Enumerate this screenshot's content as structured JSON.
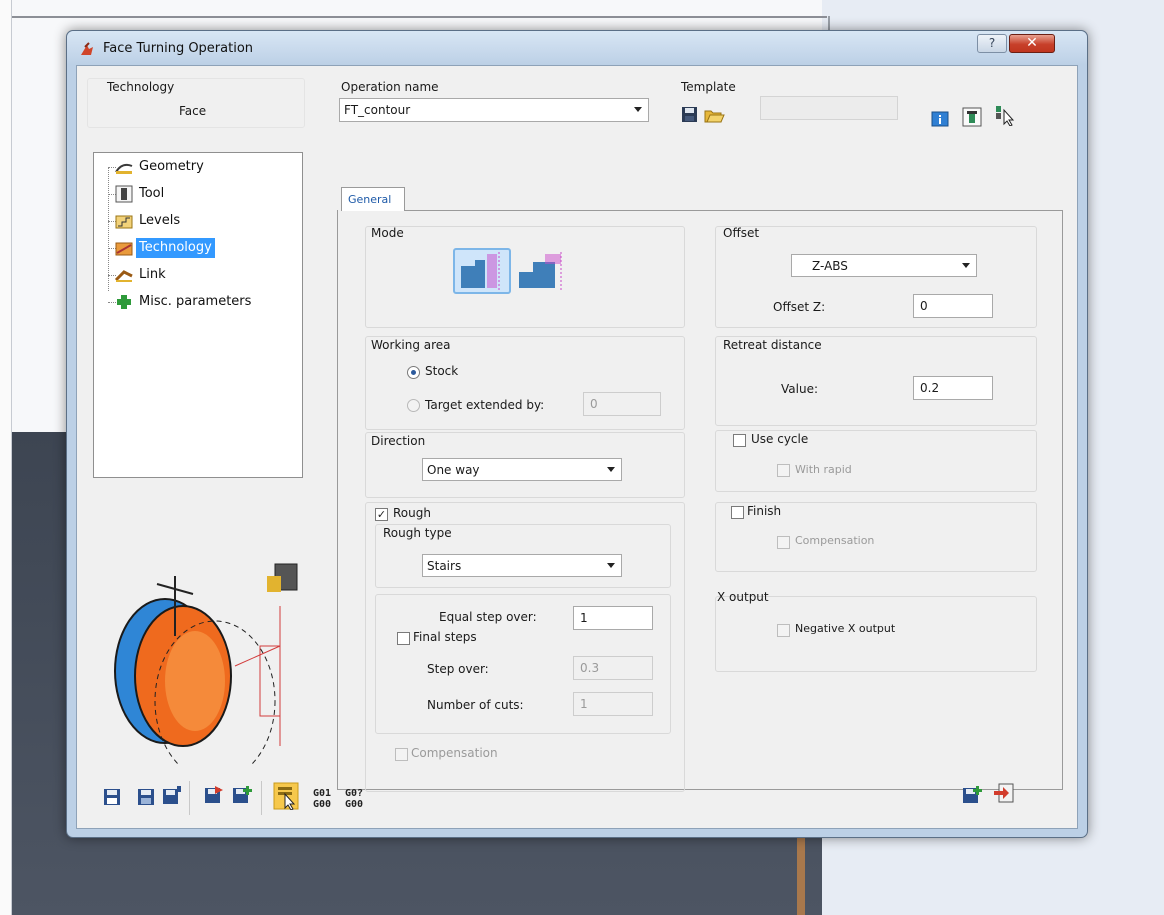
{
  "window": {
    "title": "Face Turning Operation",
    "help_label": "?",
    "close_label": "✕"
  },
  "header": {
    "technology_label": "Technology",
    "technology_value": "Face",
    "operation_name_label": "Operation name",
    "operation_name_value": "FT_contour",
    "template_label": "Template",
    "template_value": ""
  },
  "tree": {
    "items": [
      {
        "label": "Geometry",
        "icon": "geometry-icon"
      },
      {
        "label": "Tool",
        "icon": "tool-icon"
      },
      {
        "label": "Levels",
        "icon": "levels-icon"
      },
      {
        "label": "Technology",
        "icon": "technology-icon",
        "selected": true
      },
      {
        "label": "Link",
        "icon": "link-icon"
      },
      {
        "label": "Misc. parameters",
        "icon": "plus-icon"
      }
    ]
  },
  "tabs": [
    {
      "label": "General",
      "active": true
    }
  ],
  "general": {
    "mode_label": "Mode",
    "working_area_label": "Working area",
    "stock_label": "Stock",
    "stock_selected": true,
    "target_extended_label": "Target extended by:",
    "target_extended_value": "0",
    "direction_label": "Direction",
    "direction_value": "One way",
    "rough_label": "Rough",
    "rough_checked": true,
    "rough_type_label": "Rough type",
    "rough_type_value": "Stairs",
    "equal_step_over_label": "Equal step over:",
    "equal_step_over_value": "1",
    "final_steps_label": "Final steps",
    "final_steps_checked": false,
    "step_over_label": "Step over:",
    "step_over_value": "0.3",
    "number_of_cuts_label": "Number of cuts:",
    "number_of_cuts_value": "1",
    "compensation_label": "Compensation",
    "offset_label": "Offset",
    "offset_type_value": "Z-ABS",
    "offset_z_label": "Offset  Z:",
    "offset_z_value": "0",
    "retreat_distance_label": "Retreat distance",
    "retreat_value_label": "Value:",
    "retreat_value": "0.2",
    "use_cycle_label": "Use cycle",
    "with_rapid_label": "With rapid",
    "finish_label": "Finish",
    "finish_compensation_label": "Compensation",
    "x_output_label": "X output",
    "negative_x_output_label": "Negative X output"
  },
  "toolbar": {
    "gcode1_top": "G01",
    "gcode1_bottom": "G00",
    "gcode2_top": "G0?",
    "gcode2_bottom": "G00"
  },
  "colors": {
    "selection": "#3399ff",
    "tab_text": "#1e5aa8",
    "close_button": "#c7402a"
  }
}
